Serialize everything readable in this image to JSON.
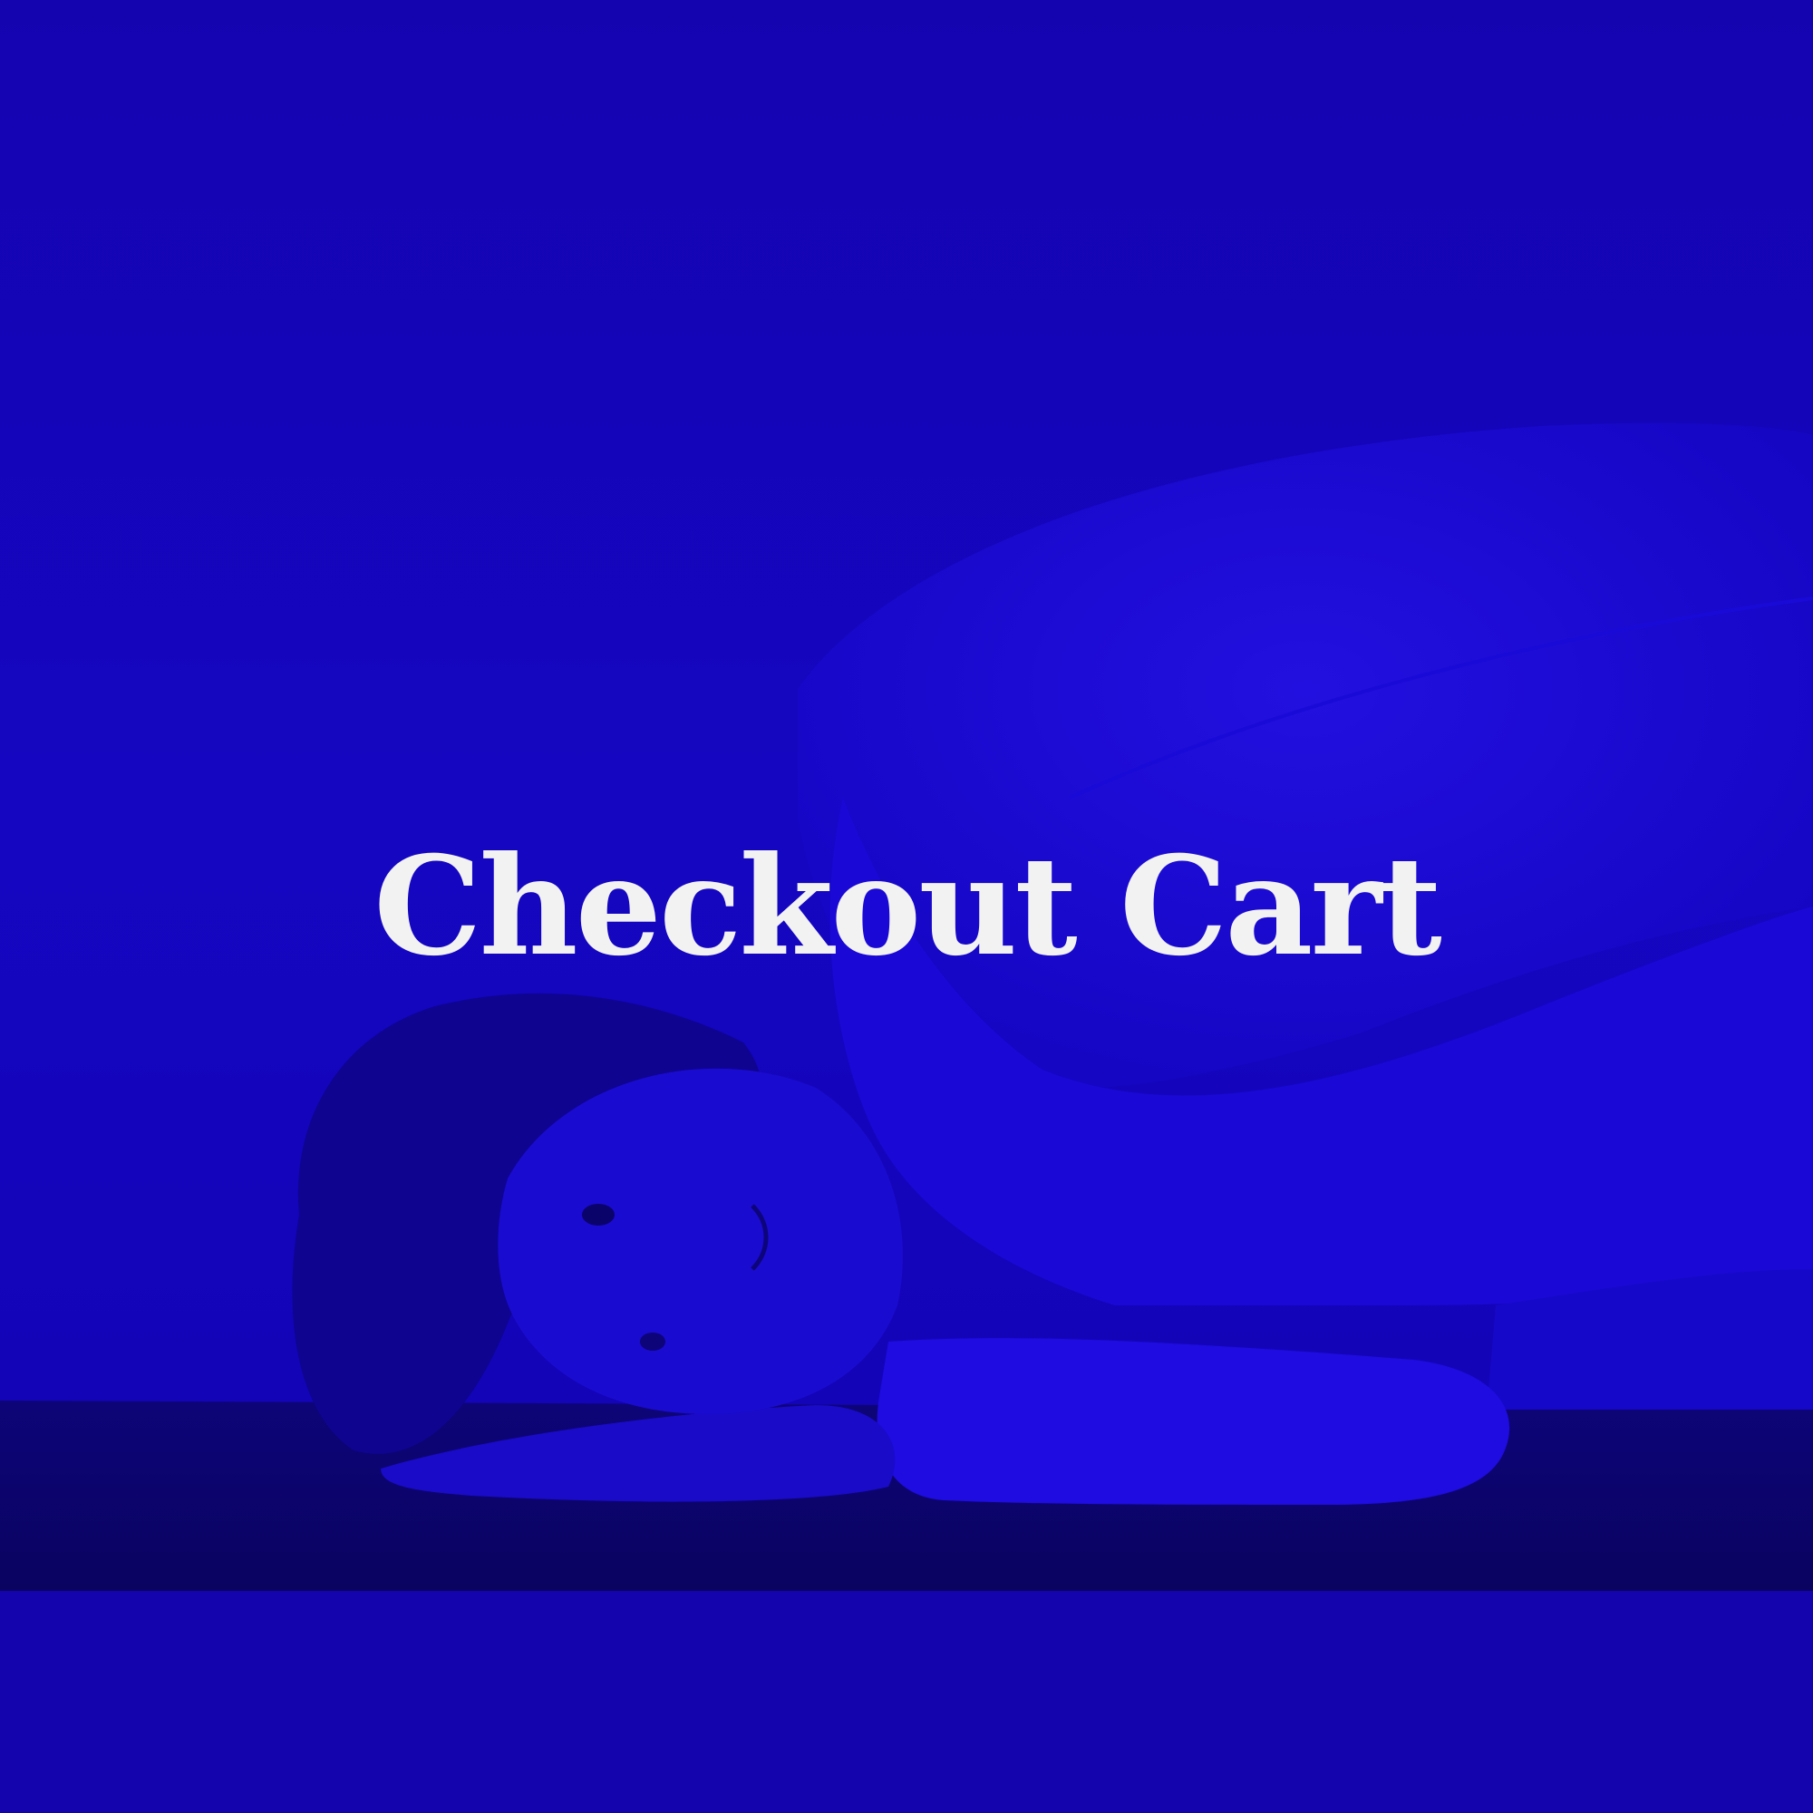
{
  "hero": {
    "title": "Checkout Cart",
    "tint_color": "#1405b8",
    "title_color": "#f2f2f2",
    "image_subject": "person-lying-on-floor-photo"
  }
}
